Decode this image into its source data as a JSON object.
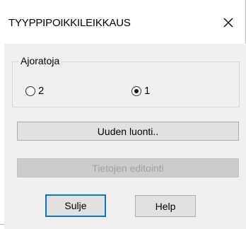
{
  "window": {
    "title": "TYYPPIPOIKKILEIKKAUS",
    "close_icon": "close-icon"
  },
  "group": {
    "label": "Ajoratoja",
    "options": [
      {
        "label": "2",
        "selected": false
      },
      {
        "label": "1",
        "selected": true
      }
    ]
  },
  "buttons": {
    "create": "Uuden luonti..",
    "edit": "Tietojen editointi",
    "close": "Sulje",
    "help": "Help"
  }
}
